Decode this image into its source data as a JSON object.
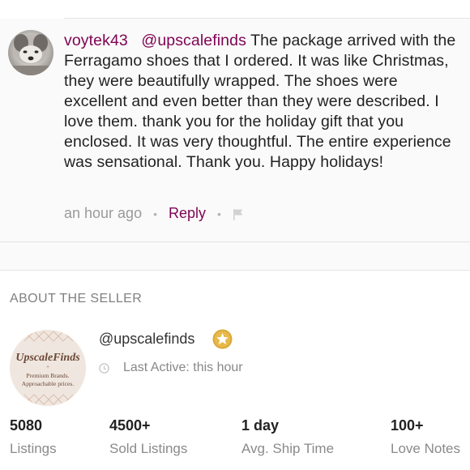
{
  "comment": {
    "username": "voytek43",
    "mention": "@upscalefinds",
    "text": "The package arrived with the Ferragamo shoes that I ordered. It was like Christmas, they were beautifully wrapped. The shoes were excellent and even better than they were described. I love them. thank you for the holiday gift that you enclosed. It was very thoughtful. The entire experience was sensational. Thank you. Happy holidays!",
    "time": "an hour ago",
    "separator": "•",
    "reply_label": "Reply",
    "flag_icon": "flag-icon",
    "avatar_icon": "dog-avatar"
  },
  "seller": {
    "section_title": "ABOUT THE SELLER",
    "handle": "@upscalefinds",
    "badge_icon": "star-badge-icon",
    "clock_icon": "clock-icon",
    "last_active": "Last Active: this hour",
    "logo": {
      "name": "UpscaleFinds",
      "tagline_line1": "Premium Brands.",
      "tagline_line2": "Approachable prices."
    },
    "stats": [
      {
        "value": "5080",
        "label": "Listings"
      },
      {
        "value": "4500+",
        "label": "Sold Listings"
      },
      {
        "value": "1 day",
        "label": "Avg. Ship Time"
      },
      {
        "value": "100+",
        "label": "Love Notes"
      }
    ]
  },
  "colors": {
    "accent": "#7f0353",
    "muted": "#9a9a9a",
    "badge_gold": "#d9a93a"
  }
}
